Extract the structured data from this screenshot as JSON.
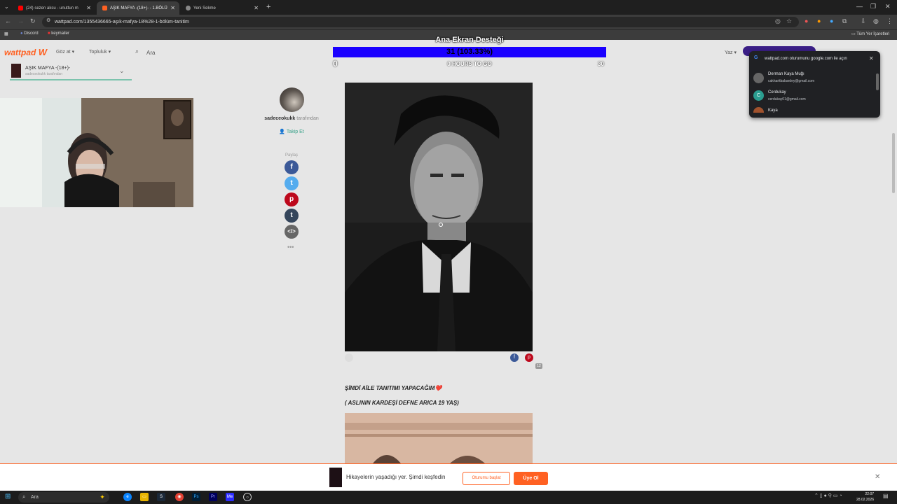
{
  "browser": {
    "tabs": [
      {
        "label": "(24) sezen aksu - unuttun m",
        "active": false
      },
      {
        "label": "AŞIK MAFYA -(18+)- - 1.BÖLÜ",
        "active": true
      },
      {
        "label": "Yeni Sekme",
        "active": false
      }
    ],
    "url": "wattpad.com/1355436665-aşık-mafya-18%28-1-bölüm-tanitim",
    "bookmarks": [
      "Discord",
      "keymailer"
    ],
    "all_bookmarks": "Tüm Yer İşaretleri"
  },
  "overlay": {
    "title": "Ana Ekran Desteği",
    "progress_text": "31 (103.33%)",
    "progress_fraction": 1.0,
    "min": "0",
    "hours_to_go": "0 HOURS TO GO",
    "max": "30"
  },
  "wattpad": {
    "logo": "wattpad",
    "nav": {
      "browse": "Göz at",
      "community": "Topluluk",
      "search": "Ara",
      "write": "Yaz"
    },
    "story": {
      "title": "AŞIK MAFYA -(18+)-",
      "author_line": "sadeceokukk tarafından"
    },
    "author": {
      "name": "sadeceokukk",
      "by": "tarafından",
      "follow": "Takip Et"
    },
    "share_label": "Paylaş",
    "comment_count": "12",
    "paragraphs": [
      "ŞİMDİ AİLE TANITIMI YAPACAĞIM❤️",
      "( ASLININ KARDEŞİ DEFNE ARICA 19 YAŞ)"
    ]
  },
  "google_popup": {
    "title": "wattpad.com oturumunu google.com ile açın",
    "accounts": [
      {
        "name": "Derman Kaya Muğı",
        "email": "cakharitbabardey@gmail.com",
        "initial": ""
      },
      {
        "name": "Cerdukay",
        "email": "cerdukay01@gmail.com",
        "initial": "C"
      },
      {
        "name": "Kaya",
        "email": "",
        "initial": ""
      }
    ]
  },
  "banner": {
    "text": "Hikayelerin yaşadığı yer. Şimdi keşfedin",
    "login": "Oturumu başlat",
    "signup": "Üye Ol"
  },
  "taskbar": {
    "search": "Ara",
    "time": "22:07",
    "date": "28.02.2026"
  },
  "colors": {
    "accent": "#ff6122",
    "progress": "#1a00ff",
    "follow": "#3aa28a"
  }
}
